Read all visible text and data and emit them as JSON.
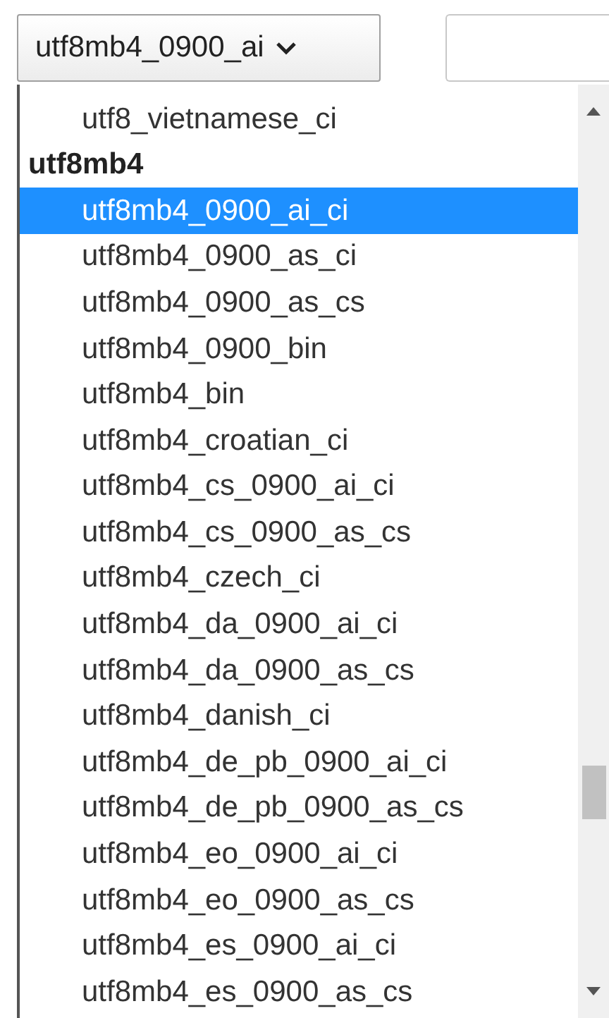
{
  "select": {
    "value": "utf8mb4_0900_ai"
  },
  "dropdown": {
    "groups": [
      {
        "options": [
          {
            "label": "utf8_vietnamese_ci",
            "selected": false
          }
        ]
      },
      {
        "label": "utf8mb4",
        "options": [
          {
            "label": "utf8mb4_0900_ai_ci",
            "selected": true
          },
          {
            "label": "utf8mb4_0900_as_ci",
            "selected": false
          },
          {
            "label": "utf8mb4_0900_as_cs",
            "selected": false
          },
          {
            "label": "utf8mb4_0900_bin",
            "selected": false
          },
          {
            "label": "utf8mb4_bin",
            "selected": false
          },
          {
            "label": "utf8mb4_croatian_ci",
            "selected": false
          },
          {
            "label": "utf8mb4_cs_0900_ai_ci",
            "selected": false
          },
          {
            "label": "utf8mb4_cs_0900_as_cs",
            "selected": false
          },
          {
            "label": "utf8mb4_czech_ci",
            "selected": false
          },
          {
            "label": "utf8mb4_da_0900_ai_ci",
            "selected": false
          },
          {
            "label": "utf8mb4_da_0900_as_cs",
            "selected": false
          },
          {
            "label": "utf8mb4_danish_ci",
            "selected": false
          },
          {
            "label": "utf8mb4_de_pb_0900_ai_ci",
            "selected": false
          },
          {
            "label": "utf8mb4_de_pb_0900_as_cs",
            "selected": false
          },
          {
            "label": "utf8mb4_eo_0900_ai_ci",
            "selected": false
          },
          {
            "label": "utf8mb4_eo_0900_as_cs",
            "selected": false
          },
          {
            "label": "utf8mb4_es_0900_ai_ci",
            "selected": false
          },
          {
            "label": "utf8mb4_es_0900_as_cs",
            "selected": false
          }
        ]
      }
    ]
  }
}
